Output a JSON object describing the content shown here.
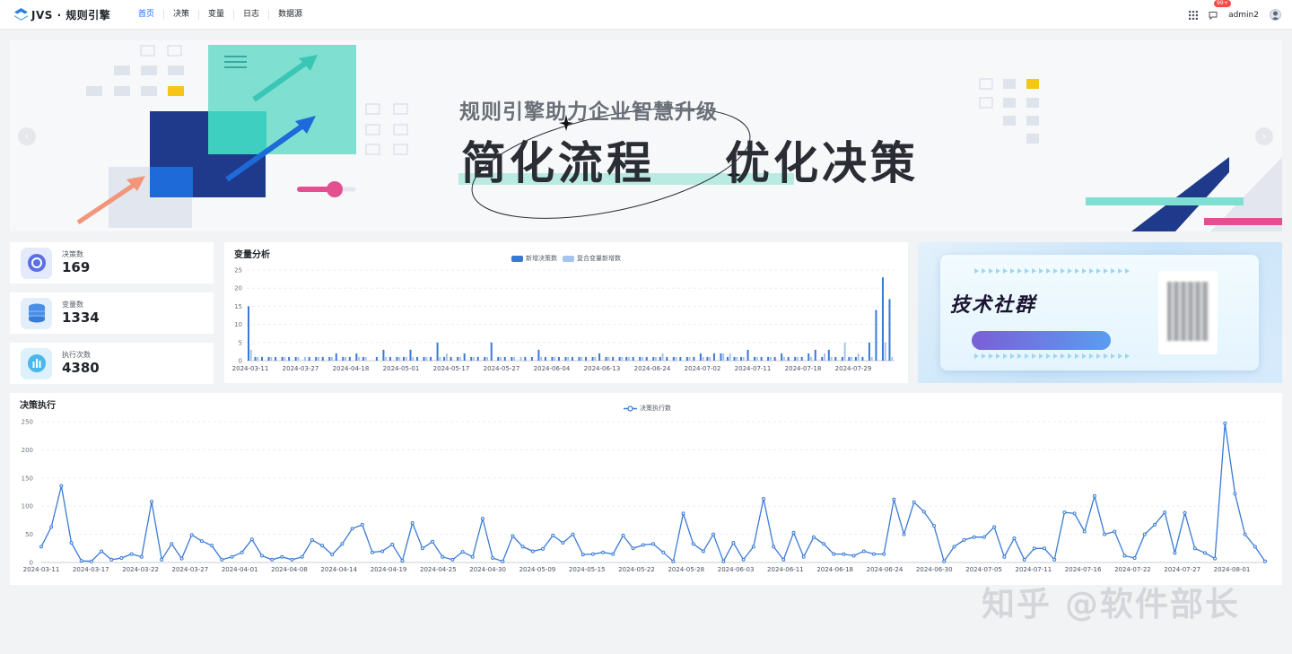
{
  "app": {
    "name": "JVS · 规则引擎"
  },
  "nav": {
    "items": [
      "首页",
      "决策",
      "变量",
      "日志",
      "数据源"
    ],
    "active": "首页"
  },
  "header": {
    "badge": "99+",
    "username": "admin2"
  },
  "banner": {
    "subtitle": "规则引擎助力企业智慧升级",
    "title_left": "简化流程",
    "title_right": "优化决策",
    "prev": "‹",
    "next": "›"
  },
  "stats": [
    {
      "label": "决策数",
      "value": "169"
    },
    {
      "label": "变量数",
      "value": "1334"
    },
    {
      "label": "执行次数",
      "value": "4380"
    }
  ],
  "colors": {
    "primary": "#1e6fff",
    "bar_dark": "#3a78d8",
    "bar_light": "#a6c4f0",
    "line": "#3a7bd5"
  },
  "variable_chart": {
    "title": "变量分析",
    "chart_data": {
      "type": "bar",
      "legend": [
        "新增决策数",
        "复合变量新增数"
      ],
      "ylim": [
        0,
        25
      ],
      "yticks": [
        0,
        5,
        10,
        15,
        20,
        25
      ],
      "xticks": [
        "2024-03-11",
        "2024-03-27",
        "2024-04-18",
        "2024-05-01",
        "2024-05-17",
        "2024-05-27",
        "2024-06-04",
        "2024-06-13",
        "2024-06-24",
        "2024-07-02",
        "2024-07-11",
        "2024-07-18",
        "2024-07-29"
      ],
      "series": [
        {
          "name": "新增决策数",
          "values": [
            15,
            1,
            1,
            1,
            1,
            1,
            1,
            1,
            0,
            1,
            1,
            1,
            1,
            2,
            1,
            1,
            2,
            1,
            0,
            1,
            3,
            1,
            1,
            1,
            3,
            1,
            1,
            1,
            5,
            1,
            1,
            1,
            2,
            1,
            1,
            1,
            5,
            1,
            1,
            1,
            0,
            1,
            1,
            3,
            1,
            1,
            1,
            1,
            1,
            1,
            1,
            1,
            2,
            1,
            1,
            1,
            1,
            1,
            1,
            1,
            1,
            1,
            1,
            1,
            1,
            1,
            1,
            2,
            1,
            2,
            2,
            1,
            1,
            1,
            3,
            1,
            1,
            1,
            1,
            2,
            1,
            1,
            1,
            2,
            3,
            1,
            3,
            1,
            1,
            1,
            1,
            1,
            5,
            14,
            23,
            17
          ]
        },
        {
          "name": "复合变量新增数",
          "values": [
            3,
            1,
            0,
            1,
            0,
            1,
            0,
            1,
            1,
            0,
            1,
            0,
            1,
            0,
            1,
            0,
            1,
            1,
            0,
            0,
            1,
            0,
            1,
            1,
            1,
            0,
            1,
            0,
            1,
            2,
            0,
            1,
            0,
            1,
            0,
            1,
            0,
            1,
            0,
            1,
            1,
            0,
            0,
            1,
            0,
            1,
            0,
            1,
            0,
            1,
            0,
            1,
            0,
            1,
            0,
            1,
            1,
            0,
            1,
            0,
            1,
            2,
            0,
            1,
            0,
            1,
            0,
            1,
            1,
            0,
            2,
            2,
            1,
            1,
            0,
            1,
            0,
            1,
            0,
            1,
            0,
            1,
            0,
            1,
            0,
            2,
            1,
            0,
            5,
            1,
            2,
            0,
            1,
            0,
            5,
            1
          ]
        }
      ]
    }
  },
  "decision_chart": {
    "title": "决策执行",
    "chart_data": {
      "type": "line",
      "legend": [
        "决策执行数"
      ],
      "ylim": [
        0,
        250
      ],
      "yticks": [
        0,
        50,
        100,
        150,
        200,
        250
      ],
      "xticks": [
        "2024-03-11",
        "2024-03-17",
        "2024-03-22",
        "2024-03-27",
        "2024-04-01",
        "2024-04-08",
        "2024-04-14",
        "2024-04-19",
        "2024-04-25",
        "2024-04-30",
        "2024-05-09",
        "2024-05-15",
        "2024-05-22",
        "2024-05-28",
        "2024-06-03",
        "2024-06-11",
        "2024-06-18",
        "2024-06-24",
        "2024-06-30",
        "2024-07-05",
        "2024-07-11",
        "2024-07-16",
        "2024-07-22",
        "2024-07-27",
        "2024-08-01"
      ],
      "series": [
        {
          "name": "决策执行数",
          "values": [
            28,
            63,
            136,
            35,
            3,
            2,
            20,
            5,
            8,
            15,
            10,
            108,
            5,
            33,
            7,
            49,
            38,
            30,
            5,
            10,
            18,
            41,
            12,
            5,
            10,
            5,
            10,
            40,
            30,
            14,
            33,
            60,
            67,
            18,
            20,
            32,
            3,
            70,
            25,
            37,
            10,
            5,
            19,
            10,
            78,
            8,
            2,
            47,
            28,
            20,
            24,
            48,
            35,
            50,
            14,
            15,
            18,
            15,
            48,
            25,
            31,
            33,
            18,
            2,
            87,
            33,
            20,
            50,
            2,
            35,
            5,
            28,
            113,
            28,
            5,
            53,
            10,
            45,
            33,
            15,
            15,
            12,
            20,
            15,
            15,
            112,
            50,
            107,
            90,
            65,
            2,
            28,
            40,
            45,
            45,
            63,
            10,
            43,
            5,
            25,
            25,
            5,
            89,
            87,
            55,
            118,
            50,
            55,
            12,
            8,
            50,
            67,
            89,
            17,
            88,
            25,
            17,
            7,
            247,
            122,
            50,
            28,
            2
          ]
        }
      ]
    }
  },
  "promo": {
    "title": "技术社群"
  },
  "watermark": "知乎 @软件部长"
}
